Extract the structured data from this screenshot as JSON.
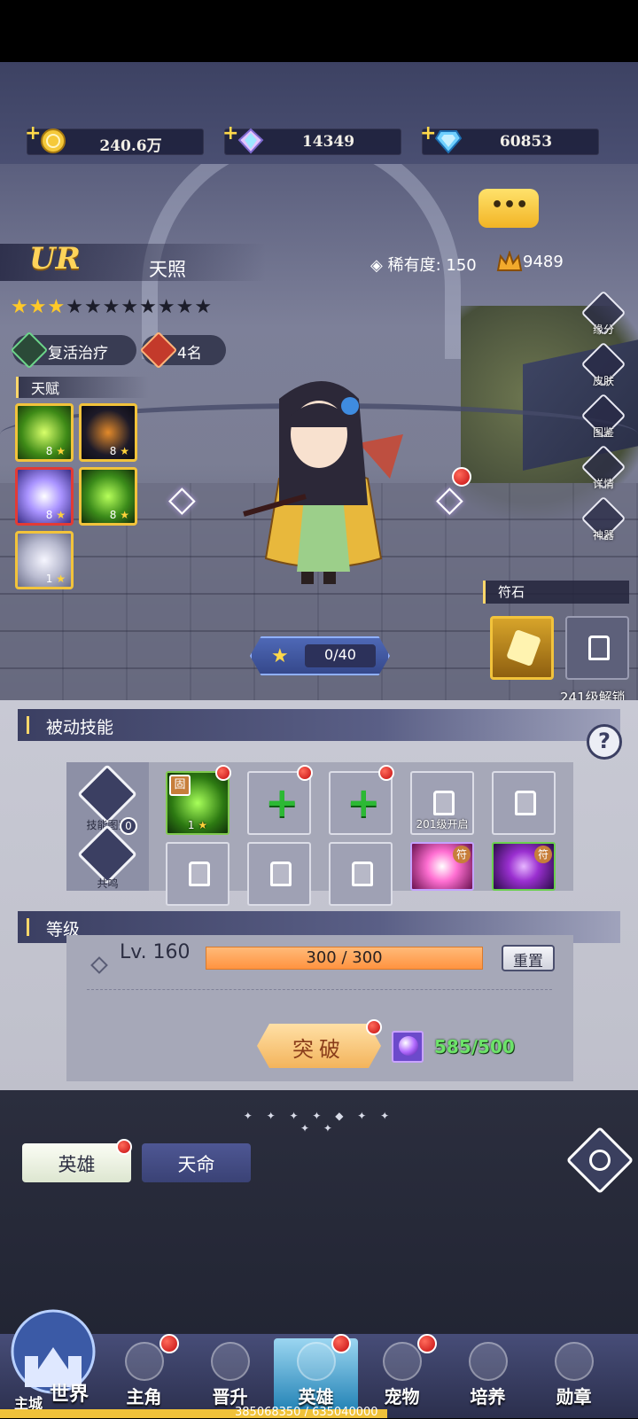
{
  "resources": [
    {
      "icon": "gold-coin-icon",
      "value": "240.6万"
    },
    {
      "icon": "rainbow-gem-icon",
      "value": "14349"
    },
    {
      "icon": "blue-diamond-icon",
      "value": "60853"
    }
  ],
  "hero": {
    "rank": "UR",
    "name": "天照",
    "rarity_label": "稀有度: 150",
    "power": "9489",
    "stars_filled": 3,
    "stars_total": 12,
    "role": "复活治疗",
    "position": "4名",
    "talent_label": "天赋",
    "talents": [
      {
        "icon": "green-swirl-icon",
        "level": "8"
      },
      {
        "icon": "shadow-figure-icon",
        "level": "8"
      },
      {
        "icon": "purple-wave-icon",
        "level": "8"
      },
      {
        "icon": "green-dragon-icon",
        "level": "8"
      },
      {
        "icon": "silver-beast-icon",
        "level": "1"
      }
    ]
  },
  "side_menu": [
    "缘分",
    "皮肤",
    "图鉴",
    "详情",
    "神器"
  ],
  "rune": {
    "label": "符石",
    "unlock_text": "241级解锁"
  },
  "exp": "0/40",
  "passive": {
    "title": "被动技能",
    "side_buttons": [
      "技能图鉴",
      "共鸣"
    ],
    "resonance_count": "0",
    "slots_row1": [
      {
        "type": "skill",
        "badge": "固",
        "level": "1"
      },
      {
        "type": "add"
      },
      {
        "type": "add"
      },
      {
        "type": "locked",
        "label": "201级开启"
      },
      {
        "type": "locked",
        "label": ""
      }
    ],
    "slots_row2": [
      {
        "type": "locked"
      },
      {
        "type": "locked"
      },
      {
        "type": "locked"
      },
      {
        "type": "skill-pink",
        "badge": "符"
      },
      {
        "type": "skill-purple",
        "badge": "符"
      }
    ]
  },
  "level": {
    "title": "等级",
    "level_text": "Lv. 160",
    "exp_text": "300 / 300",
    "exp_fraction": 1.0,
    "reset_label": "重置",
    "break_label": "突破",
    "orb_count": "585/500"
  },
  "tabs": [
    "英雄",
    "天命"
  ],
  "nav": [
    {
      "label": "主角",
      "dot": true
    },
    {
      "label": "晋升",
      "dot": false
    },
    {
      "label": "英雄",
      "dot": true,
      "active": true
    },
    {
      "label": "宠物",
      "dot": true
    },
    {
      "label": "培养",
      "dot": false
    },
    {
      "label": "勋章",
      "dot": false
    }
  ],
  "world": {
    "label": "世界",
    "sublabel": "主城"
  },
  "footer_progress": "385068350 / 635040000",
  "colors": {
    "gold": "#f2c33b",
    "accent_blue": "#4e68b6",
    "bar_orange": "#ff9340",
    "green": "#6de36a"
  }
}
